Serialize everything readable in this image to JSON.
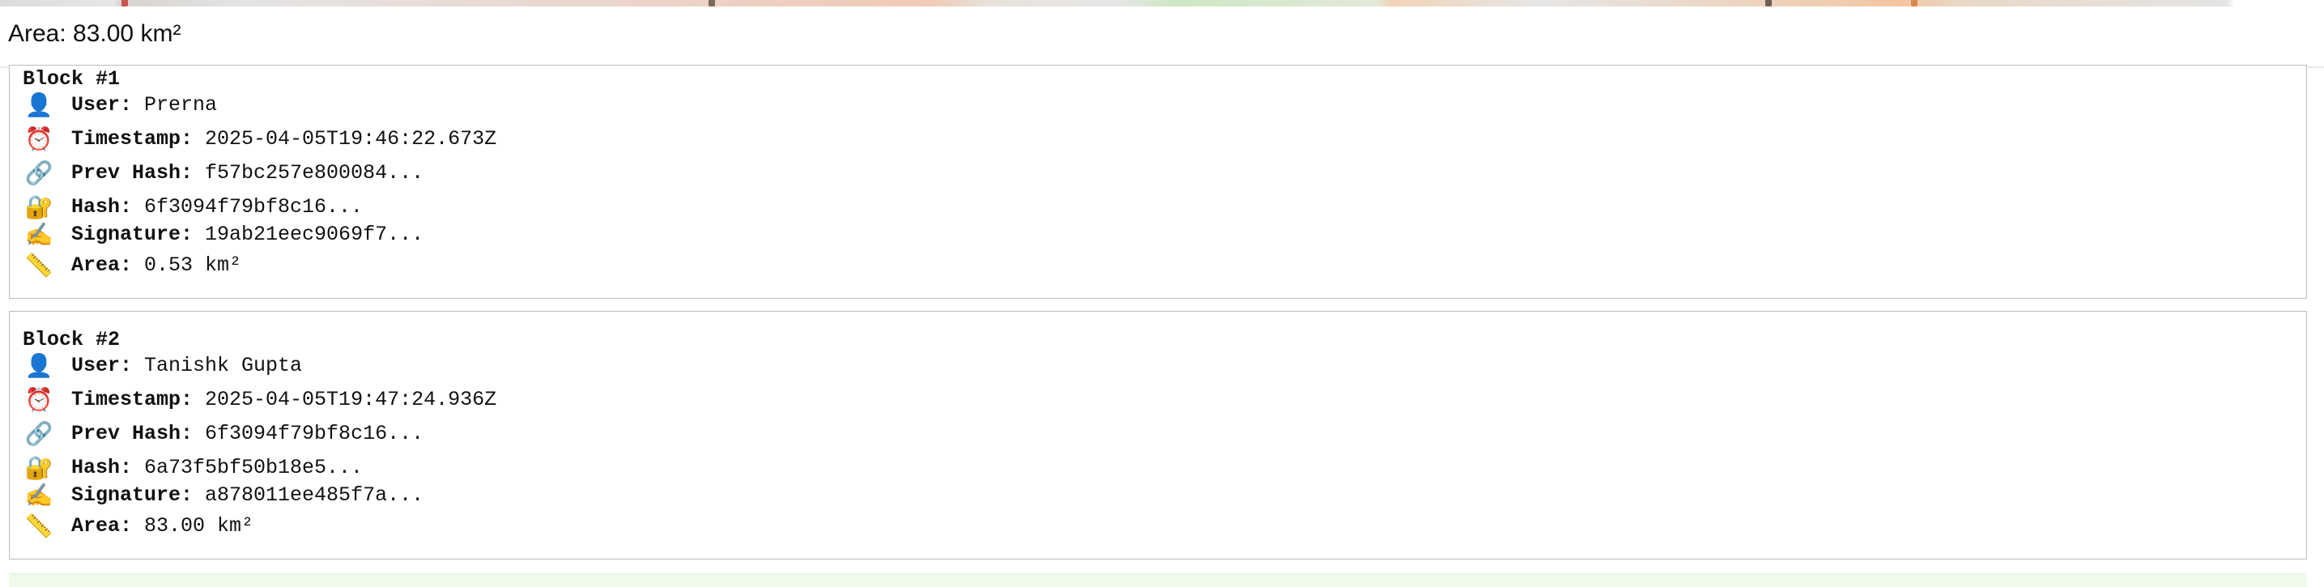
{
  "header": {
    "area_label": "Area: 83.00 km²"
  },
  "blocks": [
    {
      "title": "Block #1",
      "rows": [
        {
          "icon": "user-icon",
          "glyph": "👤",
          "key": "User:",
          "value": " Prerna"
        },
        {
          "icon": "alarm-clock-icon",
          "glyph": "⏰",
          "key": "Timestamp:",
          "value": " 2025-04-05T19:46:22.673Z"
        },
        {
          "icon": "link-icon",
          "glyph": "🔗",
          "key": "Prev Hash:",
          "value": " f57bc257e800084..."
        },
        {
          "icon": "lock-icon",
          "glyph": "🔐",
          "key": "Hash:",
          "value": " 6f3094f79bf8c16..."
        },
        {
          "icon": "writing-hand-icon",
          "glyph": "✍️",
          "key": "Signature:",
          "value": " 19ab21eec9069f7..."
        },
        {
          "icon": "ruler-icon",
          "glyph": "📏",
          "key": "Area:",
          "value": " 0.53 km²"
        }
      ]
    },
    {
      "title": "Block #2",
      "rows": [
        {
          "icon": "user-icon",
          "glyph": "👤",
          "key": "User:",
          "value": " Tanishk Gupta"
        },
        {
          "icon": "alarm-clock-icon",
          "glyph": "⏰",
          "key": "Timestamp:",
          "value": " 2025-04-05T19:47:24.936Z"
        },
        {
          "icon": "link-icon",
          "glyph": "🔗",
          "key": "Prev Hash:",
          "value": " 6f3094f79bf8c16..."
        },
        {
          "icon": "lock-icon",
          "glyph": "🔐",
          "key": "Hash:",
          "value": " 6a73f5bf50b18e5..."
        },
        {
          "icon": "writing-hand-icon",
          "glyph": "✍️",
          "key": "Signature:",
          "value": " a878011ee485f7a..."
        },
        {
          "icon": "ruler-icon",
          "glyph": "📏",
          "key": "Area:",
          "value": " 83.00 km²"
        }
      ]
    }
  ]
}
